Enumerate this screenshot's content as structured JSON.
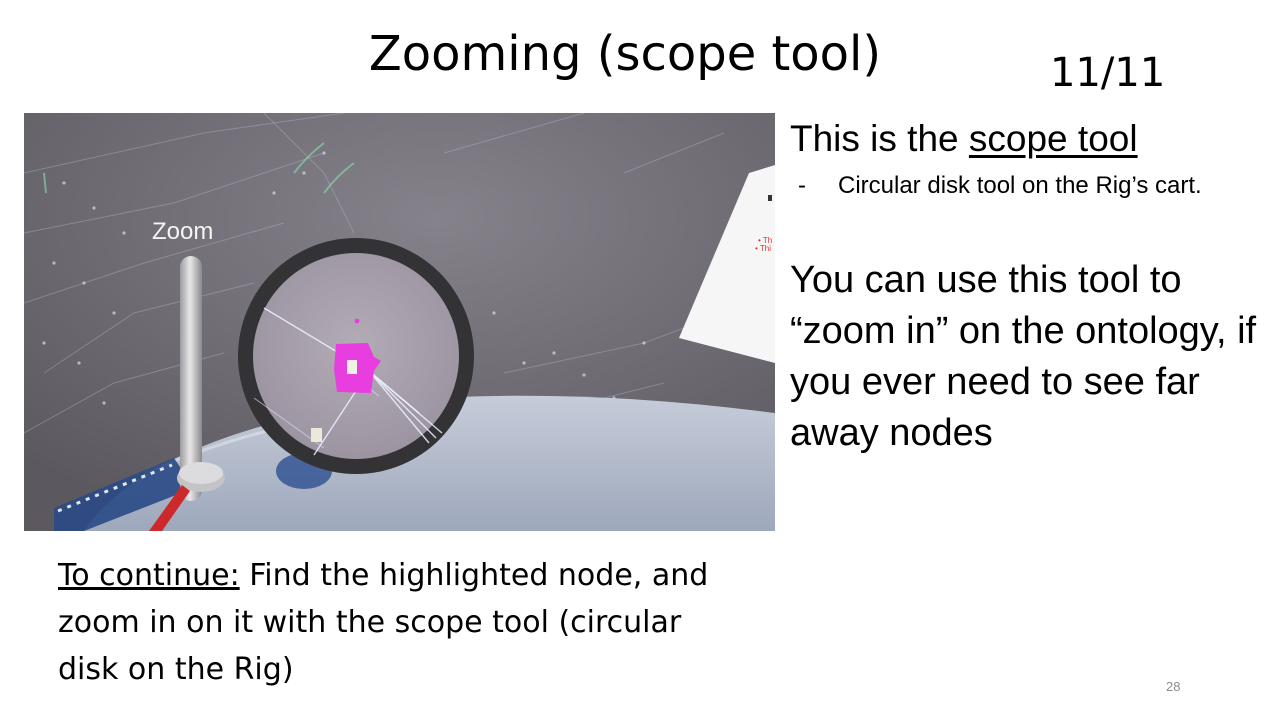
{
  "slide": {
    "title": "Zooming (scope tool)",
    "counter": "11/11",
    "page_number": "28"
  },
  "screenshot": {
    "zoom_label": "Zoom",
    "icons": [
      "zoom-slider-icon",
      "scope-lens-icon",
      "highlighted-node-icon",
      "node-icon",
      "laser-pointer-icon",
      "info-panel-icon"
    ]
  },
  "description": {
    "heading_prefix": "This is the ",
    "heading_link": "scope tool",
    "bullet_dash": "-",
    "bullet_text": "Circular disk tool on the Rig’s cart.",
    "paragraph": "You can use this tool to “zoom in” on the ontology, if you ever need to see far away nodes"
  },
  "instructions": {
    "lead": "To continue:",
    "text": " Find the highlighted node, and zoom in on it with the scope tool (circular disk on the Rig)"
  },
  "colors": {
    "highlight": "#e83ee0",
    "vr_background": "#6e6a72",
    "lens_frame": "#2f2f31"
  }
}
